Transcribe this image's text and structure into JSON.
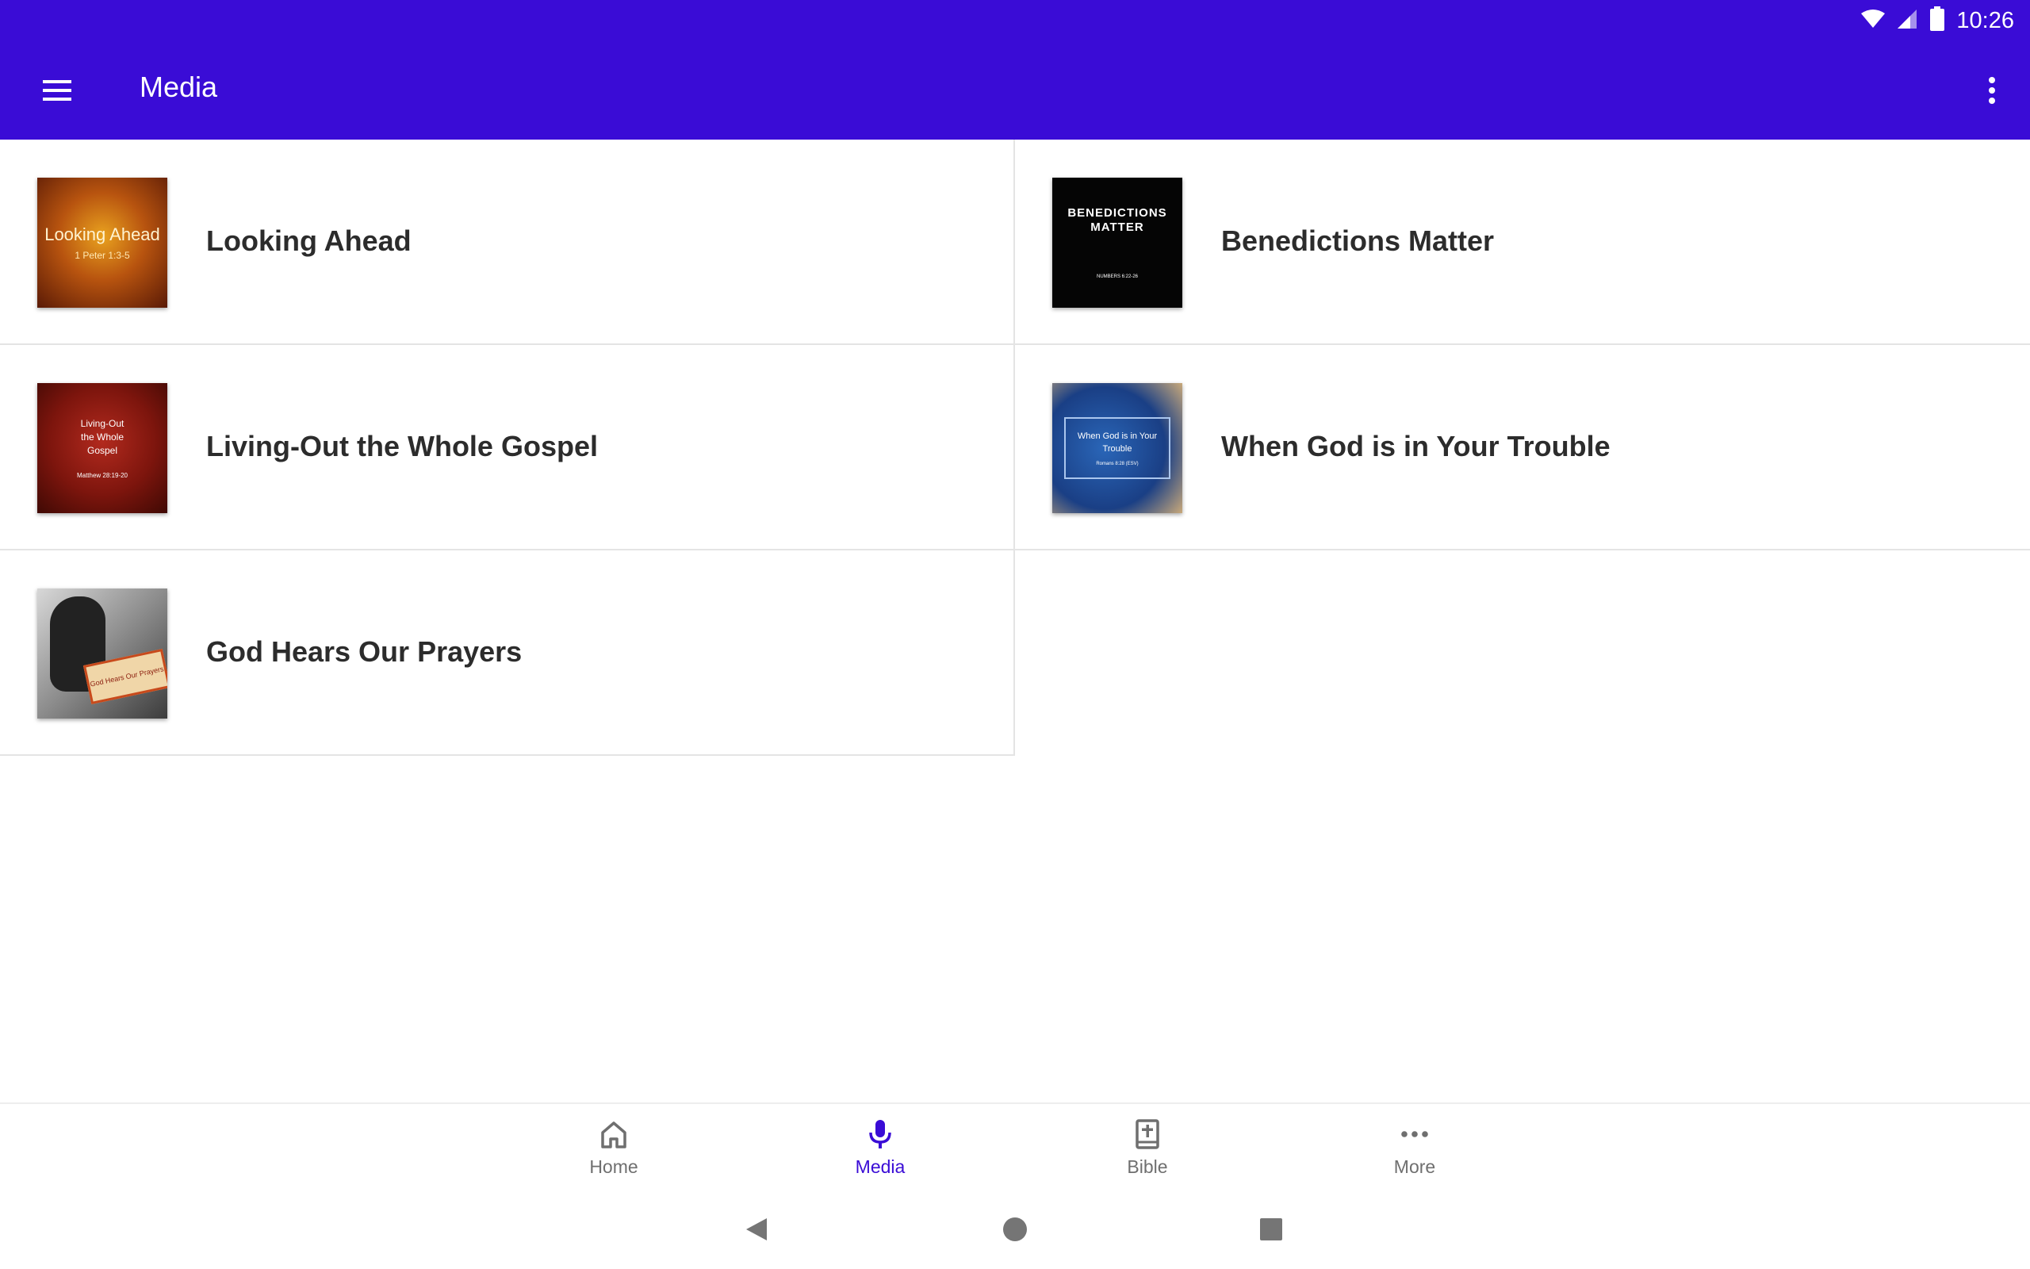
{
  "status_bar": {
    "time": "10:26"
  },
  "app_bar": {
    "title": "Media"
  },
  "media_items": [
    {
      "title": "Looking Ahead",
      "thumb_line1": "Looking Ahead",
      "thumb_line2": "1 Peter 1:3-5"
    },
    {
      "title": "Benedictions Matter",
      "thumb_line1": "BENEDICTIONS MATTER",
      "thumb_line2": "NUMBERS 6:22-26"
    },
    {
      "title": "Living-Out the Whole Gospel",
      "thumb_line1": "Living-Out the Whole Gospel",
      "thumb_line2": "Matthew 28:19-20"
    },
    {
      "title": "When God is in Your Trouble",
      "thumb_line1": "When God is in Your Trouble",
      "thumb_line2": "Romans 8:28 (ESV)"
    },
    {
      "title": "God Hears Our Prayers",
      "thumb_line1": "God Hears Our Prayers"
    }
  ],
  "bottom_nav": {
    "home": "Home",
    "media": "Media",
    "bible": "Bible",
    "more": "More"
  },
  "colors": {
    "primary": "#3a0cd6",
    "text": "#2c2c2c",
    "inactive": "#6f6f6f"
  }
}
